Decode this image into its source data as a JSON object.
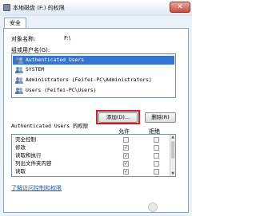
{
  "window": {
    "title": "本地磁盘 (F:) 的权限",
    "close_glyph": "✕"
  },
  "tabs": [
    {
      "label": "安全"
    }
  ],
  "object": {
    "label": "对象名称:",
    "value": "F:\\"
  },
  "groups": {
    "label": "组或用户名(G):",
    "items": [
      {
        "label": "Authenticated Users",
        "selected": true
      },
      {
        "label": "SYSTEM",
        "selected": false
      },
      {
        "label": "Administrators (Feifei-PC\\Administrators)",
        "selected": false
      },
      {
        "label": "Users (Feifei-PC\\Users)",
        "selected": false
      }
    ]
  },
  "buttons": {
    "add": "添加(D)...",
    "remove": "删除(R)"
  },
  "permissions": {
    "header": "Authenticated Users 的权限",
    "allow": "允许",
    "deny": "拒绝",
    "items": [
      {
        "name": "完全控制",
        "allow": false,
        "deny": false
      },
      {
        "name": "修改",
        "allow": true,
        "deny": false
      },
      {
        "name": "读取和执行",
        "allow": true,
        "deny": false
      },
      {
        "name": "列出文件夹内容",
        "allow": true,
        "deny": false
      },
      {
        "name": "读取",
        "allow": true,
        "deny": false
      }
    ]
  },
  "help_link": "了解访问控制和权限",
  "check_glyph": "✓",
  "scroll": {
    "up": "▲",
    "down": "▼"
  },
  "colors": {
    "selection": "#3375d7",
    "highlight_box": "#d8171e",
    "link": "#1a5cc4"
  }
}
